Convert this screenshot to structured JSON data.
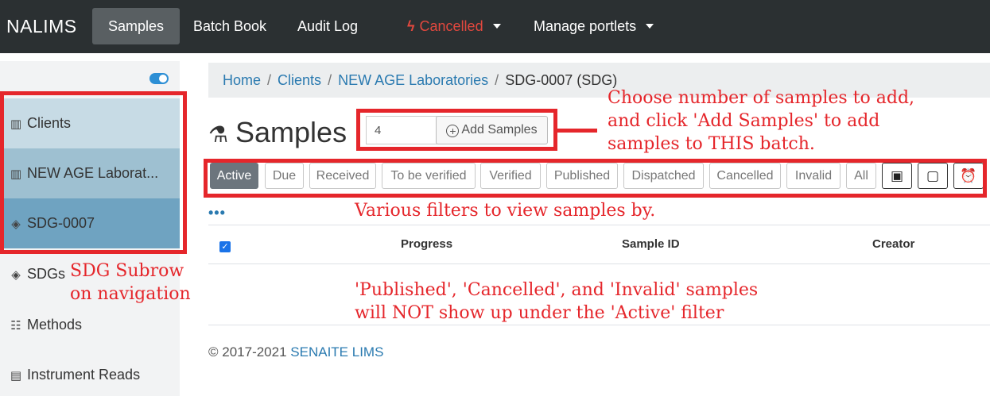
{
  "topnav": {
    "brand": "NALIMS",
    "items": [
      {
        "label": "Samples",
        "active": true
      },
      {
        "label": "Batch Book"
      },
      {
        "label": "Audit Log"
      },
      {
        "label": "Cancelled",
        "color": "#e2483e",
        "icon": "bolt-icon"
      },
      {
        "label": "Manage portlets"
      }
    ]
  },
  "sidebar": {
    "items": [
      {
        "label": "Clients",
        "icon": "building-icon"
      },
      {
        "label": "NEW AGE Laborat...",
        "icon": "building-icon"
      },
      {
        "label": "SDG-0007",
        "icon": "layers-icon"
      },
      {
        "label": "SDGs",
        "icon": "layers-icon"
      },
      {
        "label": "Methods",
        "icon": "list-icon"
      },
      {
        "label": "Instrument Reads",
        "icon": "file-icon"
      }
    ]
  },
  "breadcrumb": {
    "items": [
      "Home",
      "Clients",
      "NEW AGE Laboratories"
    ],
    "current": "SDG-0007 (SDG)",
    "separator": "/"
  },
  "main": {
    "title": "Samples",
    "count_value": "4",
    "add_button": "Add Samples",
    "filters": [
      "Active",
      "Due",
      "Received",
      "To be verified",
      "Verified",
      "Published",
      "Dispatched",
      "Cancelled",
      "Invalid",
      "All"
    ],
    "filter_icons": [
      "clipboard-check-icon",
      "clipboard-icon",
      "alarm-clock-icon"
    ],
    "ellipsis": "•••",
    "columns": [
      "Progress",
      "Sample ID",
      "Creator"
    ]
  },
  "footer": {
    "copyright": "© 2017-2021",
    "link": "SENAITE LIMS"
  },
  "annotations": {
    "add_samples": [
      "Choose number of samples to add,",
      "and click 'Add Samples' to add",
      "samples to THIS batch."
    ],
    "filters": "Various filters to view samples by.",
    "sdg_subrow": [
      "SDG Subrow",
      "on navigation"
    ],
    "active_note": [
      "'Published', 'Cancelled', and 'Invalid' samples",
      "will NOT show up under the 'Active' filter"
    ]
  },
  "colors": {
    "navbar": "#2b3032",
    "active_nav": "#595f62",
    "annotation_red": "#e5262b",
    "link_blue": "#2a7ab0",
    "sidebar_row1": "#c7dbe5",
    "sidebar_row2": "#9ec0d1",
    "sidebar_row3": "#6fa3c1"
  }
}
